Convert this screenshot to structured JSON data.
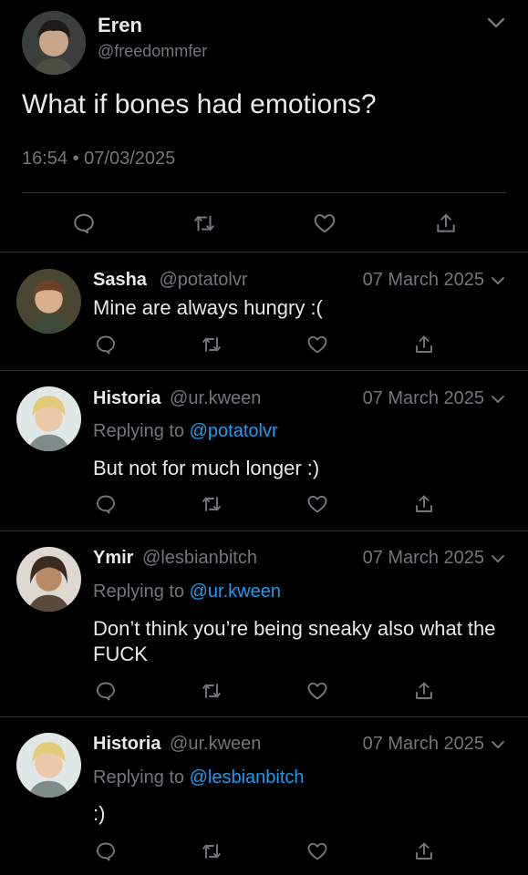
{
  "main_tweet": {
    "display_name": "Eren",
    "handle": "@freedommfer",
    "text": "What if bones had emotions?",
    "timestamp": "16:54 • 07/03/2025"
  },
  "replies": [
    {
      "display_name": "Sasha",
      "handle": "@potatolvr",
      "date": "07 March 2025",
      "replying_label": "",
      "replying_to": "",
      "text": "Mine are always hungry :("
    },
    {
      "display_name": "Historia",
      "handle": "@ur.kween",
      "date": "07 March 2025",
      "replying_label": "Replying to",
      "replying_to": "@potatolvr",
      "text": "But not for much longer :)"
    },
    {
      "display_name": "Ymir",
      "handle": "@lesbianbitch",
      "date": "07 March 2025",
      "replying_label": "Replying to",
      "replying_to": "@ur.kween",
      "text": "Don’t think you’re being sneaky also what the FUCK"
    },
    {
      "display_name": "Historia",
      "handle": "@ur.kween",
      "date": "07 March 2025",
      "replying_label": "Replying to",
      "replying_to": "@lesbianbitch",
      "text": ":)"
    }
  ],
  "icons": {
    "reply": "reply-icon",
    "retweet": "retweet-icon",
    "like": "like-icon",
    "share": "share-icon",
    "more": "chevron-down-icon"
  },
  "colors": {
    "background": "#000000",
    "text": "#e7e9ea",
    "muted": "#71767b",
    "link": "#1d9bf0",
    "divider": "#2f3336"
  }
}
